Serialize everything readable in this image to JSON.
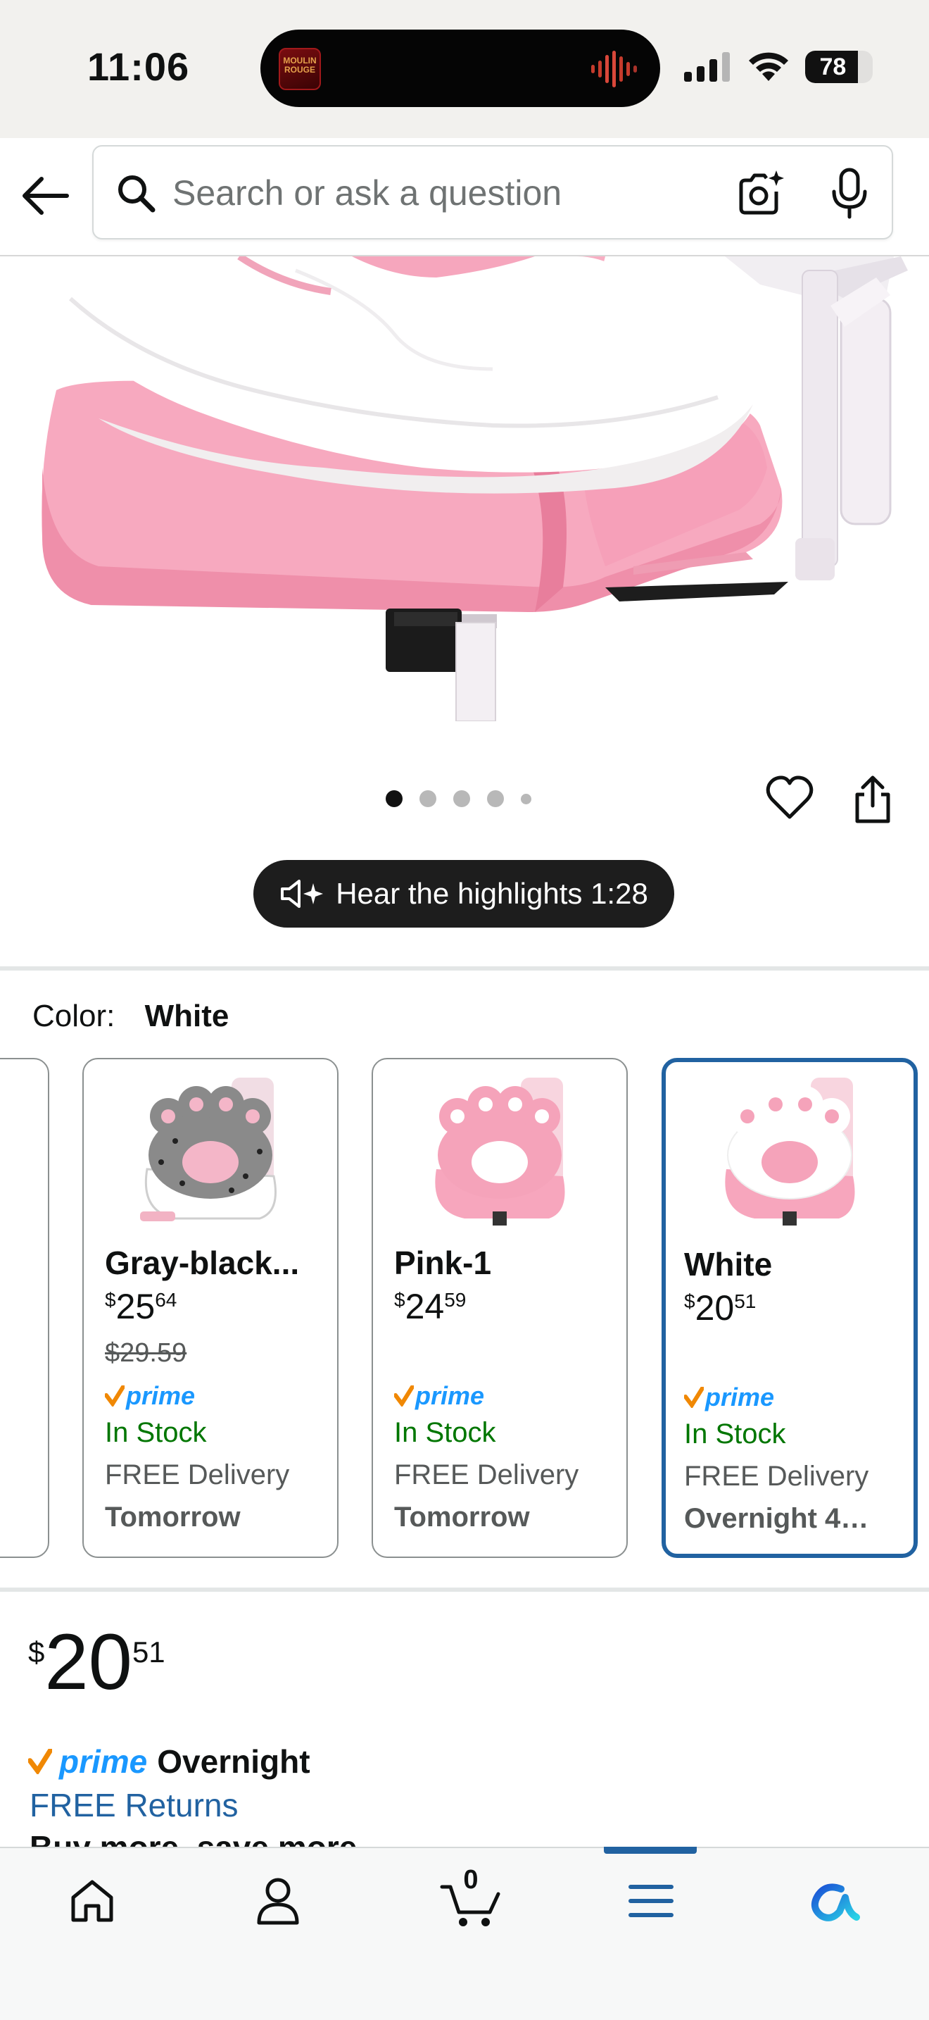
{
  "status_bar": {
    "time": "11:06",
    "battery_level": 78,
    "battery_label": "78",
    "island_art_label": "MOULIN ROUGE",
    "icons": [
      "signal-icon",
      "wifi-icon",
      "battery-icon"
    ]
  },
  "search": {
    "placeholder": "Search or ask a question",
    "value": "",
    "icons": [
      "back-arrow-icon",
      "search-icon",
      "camera-sparkle-icon",
      "microphone-icon"
    ]
  },
  "gallery": {
    "image_count": 5,
    "active_index": 0,
    "icons": [
      "heart-icon",
      "share-icon"
    ]
  },
  "highlights": {
    "label": "Hear the highlights 1:28",
    "icon": "speaker-sparkle-icon"
  },
  "color": {
    "label": "Color:",
    "value": "White",
    "options": [
      {
        "name": "Gray-black...",
        "price_whole": "25",
        "price_frac": "64",
        "price_symbol": "$",
        "list_price": "$29.59",
        "prime": "prime",
        "stock": "In Stock",
        "delivery": "FREE Delivery",
        "date": "Tomorrow",
        "selected": false
      },
      {
        "name": "Pink-1",
        "price_whole": "24",
        "price_frac": "59",
        "price_symbol": "$",
        "list_price": "",
        "prime": "prime",
        "stock": "In Stock",
        "delivery": "FREE Delivery",
        "date": "Tomorrow",
        "selected": false
      },
      {
        "name": "White",
        "price_whole": "20",
        "price_frac": "51",
        "price_symbol": "$",
        "list_price": "",
        "prime": "prime",
        "stock": "In Stock",
        "delivery": "FREE Delivery",
        "date": "Overnight 4…",
        "selected": true
      }
    ]
  },
  "price": {
    "symbol": "$",
    "whole": "20",
    "fraction": "51"
  },
  "shipping": {
    "prime_label": "prime",
    "speed": "Overnight",
    "returns": "FREE Returns",
    "promo": "Buy more, save more"
  },
  "bottom_nav": {
    "items": [
      "home-icon",
      "account-icon",
      "cart-icon",
      "menu-icon",
      "rufus-icon"
    ],
    "cart_count": "0",
    "active_item": "menu-icon"
  },
  "colors": {
    "accent_blue": "#2162a1",
    "prime_blue": "#1a98ff",
    "stock_green": "#007600",
    "pink": "#f4a6bd"
  }
}
